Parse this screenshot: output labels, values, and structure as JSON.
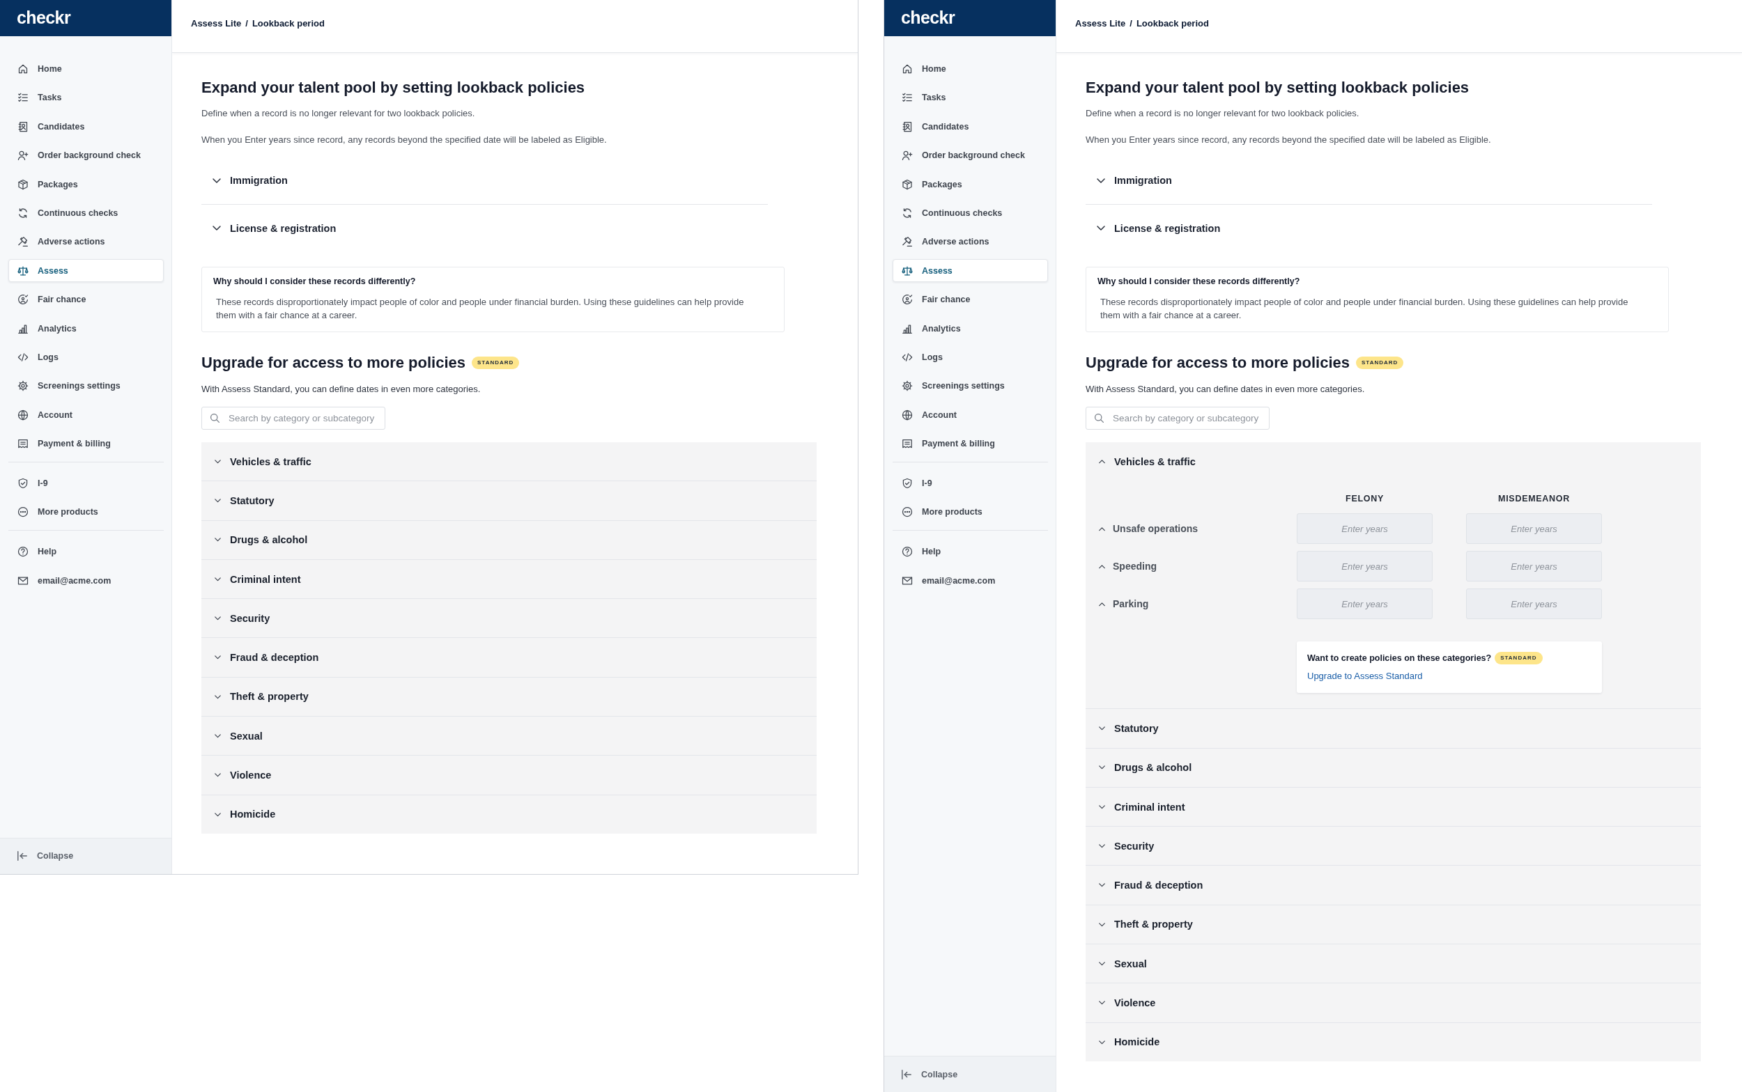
{
  "frames": [
    {
      "sidebar": {
        "logo": "checkr",
        "sections": [
          {
            "items": [
              {
                "label": "Home",
                "selected": false
              },
              {
                "label": "Tasks",
                "selected": false
              },
              {
                "label": "Candidates",
                "selected": false
              },
              {
                "label": "Order background check",
                "selected": false
              },
              {
                "label": "Packages",
                "selected": false
              },
              {
                "label": "Continuous checks",
                "selected": false
              },
              {
                "label": "Adverse actions",
                "selected": false
              },
              {
                "label": "Assess",
                "selected": true
              },
              {
                "label": "Fair chance",
                "selected": false
              },
              {
                "label": "Analytics",
                "selected": false
              },
              {
                "label": "Logs",
                "selected": false
              },
              {
                "label": "Screenings settings",
                "selected": false
              },
              {
                "label": "Account",
                "selected": false
              },
              {
                "label": "Payment & billing",
                "selected": false
              }
            ]
          },
          {
            "items": [
              {
                "label": "I-9",
                "selected": false
              },
              {
                "label": "More products",
                "selected": false
              }
            ]
          },
          {
            "items": [
              {
                "label": "Help",
                "selected": false
              },
              {
                "label": "email@acme.com",
                "selected": false
              }
            ]
          }
        ],
        "collapse": "Collapse"
      },
      "breadcrumb": {
        "items": [
          "Assess Lite",
          "Lookback period"
        ],
        "separator": "/"
      },
      "title": "Expand your talent pool by setting lookback policies",
      "intro": [
        "Define when a record is no longer relevant for two lookback policies.",
        "When you Enter years since record, any records beyond the specified date will be labeled as Eligible."
      ],
      "lite_sections": [
        {
          "label": "Immigration",
          "expanded": false
        },
        {
          "label": "License & registration",
          "expanded": false
        }
      ],
      "info": {
        "title": "Why should I consider these records differently?",
        "text": "These records disproportionately impact people of color and people under financial burden. Using these guidelines can help provide them with a fair chance at a career."
      },
      "upgrade": {
        "title": "Upgrade for access to more policies",
        "badge": "STANDARD",
        "text": "With Assess Standard, you can define dates in even more categories.",
        "search": {
          "placeholder": "Search by category or subcategory"
        },
        "categories": [
          {
            "label": "Vehicles & traffic",
            "expanded": false
          },
          {
            "label": "Statutory",
            "expanded": false
          },
          {
            "label": "Drugs & alcohol",
            "expanded": false
          },
          {
            "label": "Criminal intent",
            "expanded": false
          },
          {
            "label": "Security",
            "expanded": false
          },
          {
            "label": "Fraud & deception",
            "expanded": false
          },
          {
            "label": "Theft & property",
            "expanded": false
          },
          {
            "label": "Sexual",
            "expanded": false
          },
          {
            "label": "Violence",
            "expanded": false
          },
          {
            "label": "Homicide",
            "expanded": false
          }
        ]
      }
    },
    {
      "sidebar": {
        "logo": "checkr",
        "sections": [
          {
            "items": [
              {
                "label": "Home",
                "selected": false
              },
              {
                "label": "Tasks",
                "selected": false
              },
              {
                "label": "Candidates",
                "selected": false
              },
              {
                "label": "Order background check",
                "selected": false
              },
              {
                "label": "Packages",
                "selected": false
              },
              {
                "label": "Continuous checks",
                "selected": false
              },
              {
                "label": "Adverse actions",
                "selected": false
              },
              {
                "label": "Assess",
                "selected": true
              },
              {
                "label": "Fair chance",
                "selected": false
              },
              {
                "label": "Analytics",
                "selected": false
              },
              {
                "label": "Logs",
                "selected": false
              },
              {
                "label": "Screenings settings",
                "selected": false
              },
              {
                "label": "Account",
                "selected": false
              },
              {
                "label": "Payment & billing",
                "selected": false
              }
            ]
          },
          {
            "items": [
              {
                "label": "I-9",
                "selected": false
              },
              {
                "label": "More products",
                "selected": false
              }
            ]
          },
          {
            "items": [
              {
                "label": "Help",
                "selected": false
              },
              {
                "label": "email@acme.com",
                "selected": false
              }
            ]
          }
        ],
        "collapse": "Collapse"
      },
      "breadcrumb": {
        "items": [
          "Assess Lite",
          "Lookback period"
        ],
        "separator": "/"
      },
      "title": "Expand your talent pool by setting lookback policies",
      "intro": [
        "Define when a record is no longer relevant for two lookback policies.",
        "When you Enter years since record, any records beyond the specified date will be labeled as Eligible."
      ],
      "lite_sections": [
        {
          "label": "Immigration",
          "expanded": false
        },
        {
          "label": "License & registration",
          "expanded": false
        }
      ],
      "info": {
        "title": "Why should I consider these records differently?",
        "text": "These records disproportionately impact people of color and people under financial burden. Using these guidelines can help provide them with a fair chance at a career."
      },
      "upgrade": {
        "title": "Upgrade for access to more policies",
        "badge": "STANDARD",
        "text": "With Assess Standard, you can define dates in even more categories.",
        "search": {
          "placeholder": "Search by category or subcategory"
        },
        "categories": [
          {
            "label": "Vehicles & traffic",
            "expanded": true,
            "columns": [
              "FELONY",
              "MISDEMEANOR"
            ],
            "subcategories": [
              {
                "label": "Unsafe operations",
                "expanded": true,
                "fields": [
                  {
                    "placeholder": "Enter years"
                  },
                  {
                    "placeholder": "Enter years"
                  }
                ]
              },
              {
                "label": "Speeding",
                "expanded": true,
                "fields": [
                  {
                    "placeholder": "Enter years"
                  },
                  {
                    "placeholder": "Enter years"
                  }
                ]
              },
              {
                "label": "Parking",
                "expanded": true,
                "fields": [
                  {
                    "placeholder": "Enter years"
                  },
                  {
                    "placeholder": "Enter years"
                  }
                ]
              }
            ],
            "upsell": {
              "text": "Want to create policies on these categories?",
              "badge": "STANDARD",
              "link": "Upgrade to Assess Standard"
            }
          },
          {
            "label": "Statutory",
            "expanded": false
          },
          {
            "label": "Drugs & alcohol",
            "expanded": false
          },
          {
            "label": "Criminal intent",
            "expanded": false
          },
          {
            "label": "Security",
            "expanded": false
          },
          {
            "label": "Fraud & deception",
            "expanded": false
          },
          {
            "label": "Theft & property",
            "expanded": false
          },
          {
            "label": "Sexual",
            "expanded": false
          },
          {
            "label": "Violence",
            "expanded": false
          },
          {
            "label": "Homicide",
            "expanded": false
          }
        ]
      }
    }
  ]
}
